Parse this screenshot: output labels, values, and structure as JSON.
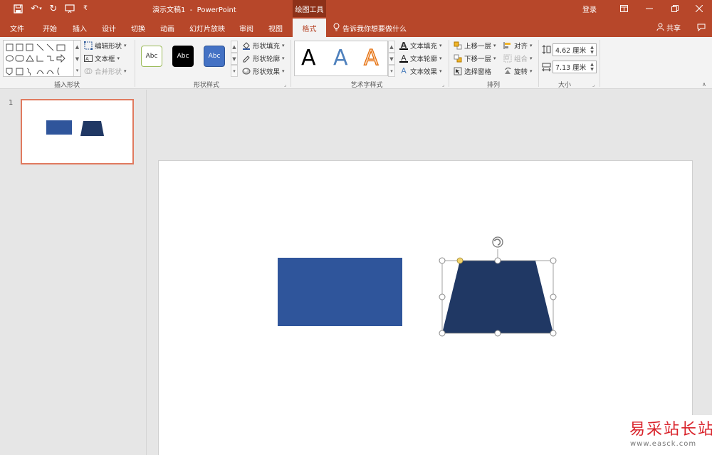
{
  "titlebar": {
    "title": "演示文稿1  -  PowerPoint",
    "contextual_group": "绘图工具",
    "login": "登录"
  },
  "tabs": [
    "文件",
    "开始",
    "插入",
    "设计",
    "切换",
    "动画",
    "幻灯片放映",
    "审阅",
    "视图"
  ],
  "active_tab": "格式",
  "tell_me": "告诉我你想要做什么",
  "share": "共享",
  "ribbon": {
    "insert_shapes": {
      "label": "插入形状",
      "edit_shape": "编辑形状",
      "text_box": "文本框",
      "merge_shapes": "合并形状"
    },
    "shape_styles": {
      "label": "形状样式",
      "thumbs": [
        "Abc",
        "Abc",
        "Abc"
      ],
      "fill": "形状填充",
      "outline": "形状轮廓",
      "effects": "形状效果"
    },
    "wordart_styles": {
      "label": "艺术字样式",
      "letters": [
        "A",
        "A",
        "A"
      ],
      "text_fill": "文本填充",
      "text_outline": "文本轮廓",
      "text_effects": "文本效果"
    },
    "arrange": {
      "label": "排列",
      "bring_forward": "上移一层",
      "send_backward": "下移一层",
      "selection_pane": "选择窗格",
      "align": "对齐",
      "group": "组合",
      "rotate": "旋转"
    },
    "size": {
      "label": "大小",
      "height": "4.62 厘米",
      "width": "7.13 厘米"
    }
  },
  "thumbnail": {
    "slide_number": "1"
  },
  "colors": {
    "ppt_red": "#b7472a",
    "rect_fill": "#2f559b",
    "trapezoid_fill": "#203864",
    "thumb_border": "#e07a5f"
  },
  "watermark": {
    "text": "易采站长站",
    "url": "www.easck.com"
  }
}
